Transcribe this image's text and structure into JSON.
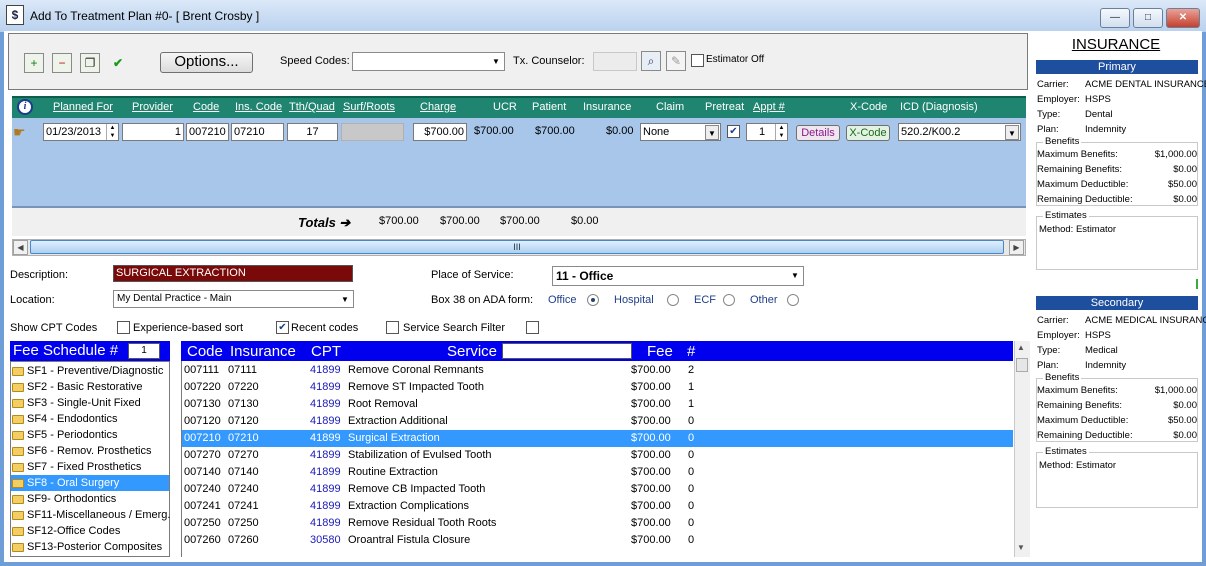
{
  "window": {
    "title": "Add To Treatment Plan #0- [ Brent Crosby ]",
    "app_icon": "$",
    "minimize": "—",
    "maximize": "□",
    "close": "✕"
  },
  "toolbar": {
    "options_label": "Options...",
    "speed_codes_label": "Speed Codes:",
    "speed_codes_value": "",
    "counselor_label": "Tx. Counselor:",
    "counselor_value": "",
    "estimator_off_label": "Estimator Off"
  },
  "grid": {
    "headers": {
      "planned_for": "Planned For",
      "provider": "Provider",
      "code": "Code",
      "ins_code": "Ins. Code",
      "tth_quad": "Tth/Quad",
      "surf_roots": "Surf/Roots",
      "charge": "Charge",
      "ucr": "UCR",
      "patient": "Patient",
      "insurance": "Insurance",
      "claim": "Claim",
      "pretreat": "Pretreat",
      "appt": "Appt #",
      "xcode": "X-Code",
      "icd": "ICD (Diagnosis)"
    },
    "row": {
      "date": "01/23/2013",
      "provider": "1",
      "code": "007210",
      "ins_code": "07210",
      "tooth": "17",
      "surf": "",
      "charge": "$700.00",
      "ucr": "$700.00",
      "patient": "$700.00",
      "insurance": "$0.00",
      "claim": "None",
      "pretreat_checked": true,
      "appt": "1",
      "details_label": "Details",
      "xcode_label": "X-Code",
      "icd": "520.2/K00.2"
    },
    "totals": {
      "label": "Totals ➔",
      "charge": "$700.00",
      "ucr": "$700.00",
      "patient": "$700.00",
      "insurance": "$0.00"
    },
    "scroll_thumb": "III"
  },
  "form": {
    "description_label": "Description:",
    "description_value": "SURGICAL EXTRACTION",
    "location_label": "Location:",
    "location_value": "My Dental Practice - Main",
    "place_label": "Place of Service:",
    "place_value": "11 - Office",
    "box38_label": "Box 38 on ADA form:",
    "box38_options": [
      "Office",
      "Hospital",
      "ECF",
      "Other"
    ],
    "box38_selected": "Office",
    "show_cpt_label": "Show CPT Codes",
    "experience_label": "Experience-based sort",
    "recent_label": "Recent codes",
    "recent_checked": true,
    "search_filter_label": "Service Search Filter"
  },
  "fee_schedule": {
    "title": "Fee Schedule #",
    "number": "1",
    "selected": "SF8 - Oral Surgery",
    "items": [
      "SF1 - Preventive/Diagnostic",
      "SF2 - Basic Restorative",
      "SF3 - Single-Unit Fixed",
      "SF4 - Endodontics",
      "SF5 - Periodontics",
      "SF6 - Remov. Prosthetics",
      "SF7 -  Fixed Prosthetics",
      "SF8 - Oral Surgery",
      "SF9- Orthodontics",
      "SF11-Miscellaneous / Emerg.",
      "SF12-Office Codes",
      "SF13-Posterior Composites"
    ]
  },
  "services": {
    "headers": {
      "code": "Code",
      "insurance": "Insurance",
      "cpt": "CPT",
      "service": "Service",
      "fee": "Fee",
      "count": "#"
    },
    "search_value": "",
    "selected_index": 4,
    "rows": [
      {
        "code": "007111",
        "ins": "07111",
        "cpt": "41899",
        "service": "Remove Coronal Remnants",
        "fee": "$700.00",
        "count": "2"
      },
      {
        "code": "007220",
        "ins": "07220",
        "cpt": "41899",
        "service": "Remove ST Impacted Tooth",
        "fee": "$700.00",
        "count": "1"
      },
      {
        "code": "007130",
        "ins": "07130",
        "cpt": "41899",
        "service": "Root Removal",
        "fee": "$700.00",
        "count": "1"
      },
      {
        "code": "007120",
        "ins": "07120",
        "cpt": "41899",
        "service": "Extraction Additional",
        "fee": "$700.00",
        "count": "0"
      },
      {
        "code": "007210",
        "ins": "07210",
        "cpt": "41899",
        "service": "Surgical Extraction",
        "fee": "$700.00",
        "count": "0"
      },
      {
        "code": "007270",
        "ins": "07270",
        "cpt": "41899",
        "service": "Stabilization of Evulsed Tooth",
        "fee": "$700.00",
        "count": "0"
      },
      {
        "code": "007140",
        "ins": "07140",
        "cpt": "41899",
        "service": "Routine Extraction",
        "fee": "$700.00",
        "count": "0"
      },
      {
        "code": "007240",
        "ins": "07240",
        "cpt": "41899",
        "service": "Remove CB Impacted Tooth",
        "fee": "$700.00",
        "count": "0"
      },
      {
        "code": "007241",
        "ins": "07241",
        "cpt": "41899",
        "service": "Extraction Complications",
        "fee": "$700.00",
        "count": "0"
      },
      {
        "code": "007250",
        "ins": "07250",
        "cpt": "41899",
        "service": "Remove Residual Tooth Roots",
        "fee": "$700.00",
        "count": "0"
      },
      {
        "code": "007260",
        "ins": "07260",
        "cpt": "30580",
        "service": "Oroantral Fistula Closure",
        "fee": "$700.00",
        "count": "0"
      }
    ]
  },
  "insurance": {
    "title": "INSURANCE",
    "primary": {
      "band": "Primary",
      "carrier_label": "Carrier:",
      "carrier": "ACME DENTAL INSURANCE",
      "employer_label": "Employer:",
      "employer": "HSPS",
      "type_label": "Type:",
      "type": "Dental",
      "plan_label": "Plan:",
      "plan": "Indemnity",
      "benefits_label": "Benefits",
      "max_benefits_label": "Maximum Benefits:",
      "max_benefits": "$1,000.00",
      "rem_benefits_label": "Remaining Benefits:",
      "rem_benefits": "$0.00",
      "max_ded_label": "Maximum Deductible:",
      "max_ded": "$50.00",
      "rem_ded_label": "Remaining Deductible:",
      "rem_ded": "$0.00",
      "estimates_label": "Estimates",
      "method_label": "Method:",
      "method": "Estimator"
    },
    "secondary": {
      "band": "Secondary",
      "carrier_label": "Carrier:",
      "carrier": "ACME MEDICAL INSURANCE",
      "employer_label": "Employer:",
      "employer": "HSPS",
      "type_label": "Type:",
      "type": "Medical",
      "plan_label": "Plan:",
      "plan": "Indemnity",
      "benefits_label": "Benefits",
      "max_benefits_label": "Maximum Benefits:",
      "max_benefits": "$1,000.00",
      "rem_benefits_label": "Remaining Benefits:",
      "rem_benefits": "$0.00",
      "max_ded_label": "Maximum Deductible:",
      "max_ded": "$50.00",
      "rem_ded_label": "Remaining Deductible:",
      "rem_ded": "$0.00",
      "estimates_label": "Estimates",
      "method_label": "Method:",
      "method": "Estimator"
    }
  },
  "colors": {
    "grid_header": "#1f8570",
    "grid_body": "#a7c6ea",
    "selection": "#3399ff",
    "list_header": "#0000ee",
    "description_bg": "#7a0a0a",
    "insurance_band": "#1e4e9e"
  }
}
